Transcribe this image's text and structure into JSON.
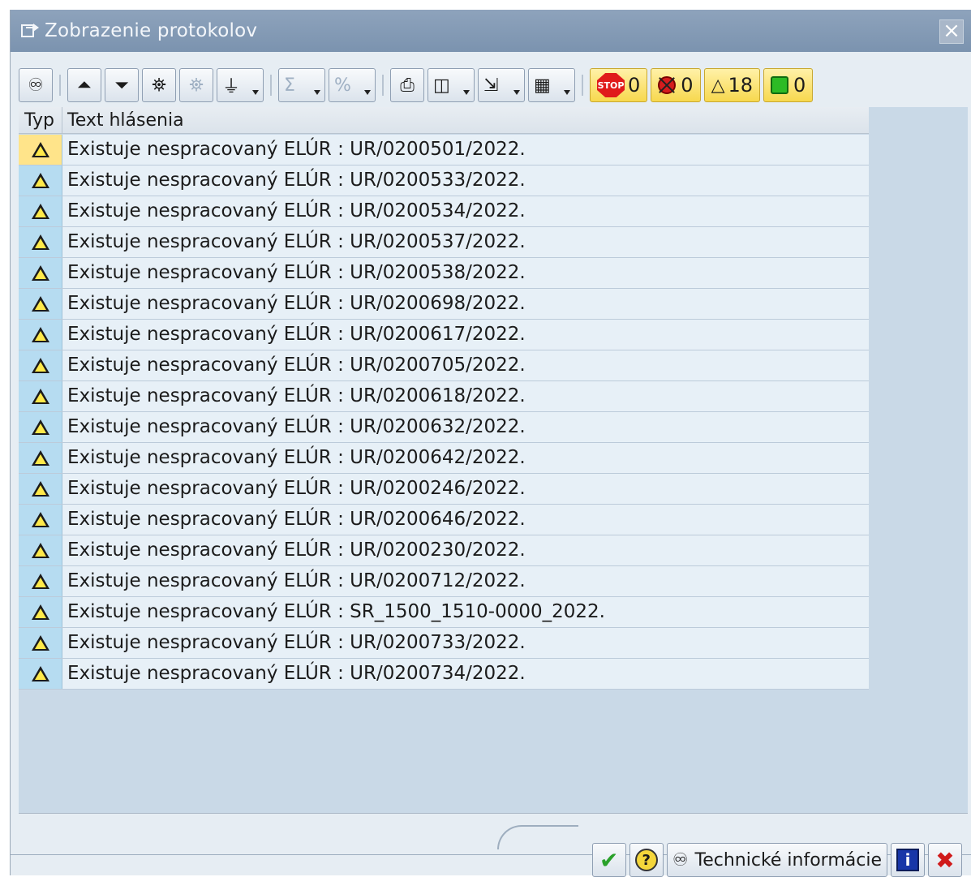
{
  "window": {
    "title": "Zobrazenie protokolov"
  },
  "toolbar": {
    "counts": {
      "stop": "0",
      "error": "0",
      "warning": "18",
      "success": "0"
    }
  },
  "grid": {
    "headers": {
      "type": "Typ",
      "text": "Text hlásenia"
    },
    "rows": [
      {
        "text": "Existuje nespracovaný ELÚR : UR/0200501/2022."
      },
      {
        "text": "Existuje nespracovaný ELÚR : UR/0200533/2022."
      },
      {
        "text": "Existuje nespracovaný ELÚR : UR/0200534/2022."
      },
      {
        "text": "Existuje nespracovaný ELÚR : UR/0200537/2022."
      },
      {
        "text": "Existuje nespracovaný ELÚR : UR/0200538/2022."
      },
      {
        "text": "Existuje nespracovaný ELÚR : UR/0200698/2022."
      },
      {
        "text": "Existuje nespracovaný ELÚR : UR/0200617/2022."
      },
      {
        "text": "Existuje nespracovaný ELÚR : UR/0200705/2022."
      },
      {
        "text": "Existuje nespracovaný ELÚR : UR/0200618/2022."
      },
      {
        "text": "Existuje nespracovaný ELÚR : UR/0200632/2022."
      },
      {
        "text": "Existuje nespracovaný ELÚR : UR/0200642/2022."
      },
      {
        "text": "Existuje nespracovaný ELÚR : UR/0200246/2022."
      },
      {
        "text": "Existuje nespracovaný ELÚR : UR/0200646/2022."
      },
      {
        "text": "Existuje nespracovaný ELÚR : UR/0200230/2022."
      },
      {
        "text": "Existuje nespracovaný ELÚR : UR/0200712/2022."
      },
      {
        "text": "Existuje nespracovaný ELÚR : SR_1500_1510-0000_2022."
      },
      {
        "text": "Existuje nespracovaný ELÚR : UR/0200733/2022."
      },
      {
        "text": "Existuje nespracovaný ELÚR : UR/0200734/2022."
      }
    ]
  },
  "footer": {
    "tech_info_label": "Technické informácie"
  }
}
